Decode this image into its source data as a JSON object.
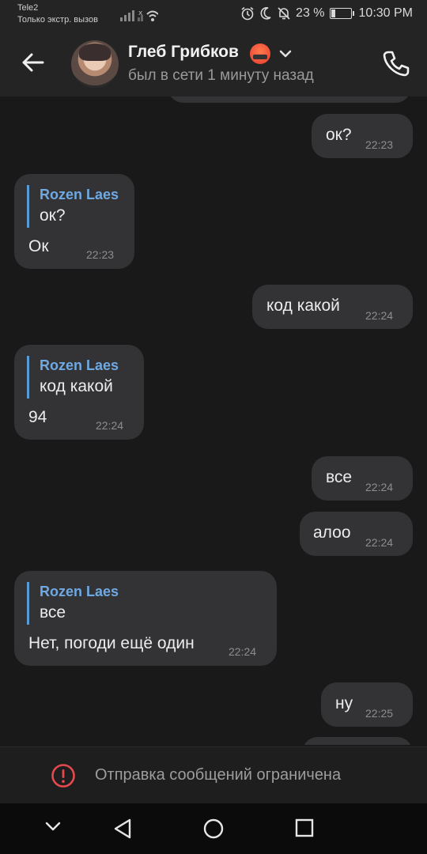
{
  "status_bar": {
    "carrier": "Tele2",
    "carrier_sub": "Только экстр. вызов",
    "battery": "23 %",
    "battery_level": 0.23,
    "time": "10:30 PM"
  },
  "header": {
    "name": "Глеб Грибков",
    "last_seen": "был в сети 1 минуту назад"
  },
  "messages": [
    {
      "text": "ок?",
      "time": "22:23"
    },
    {
      "reply_name": "Rozen Laes",
      "reply_text": "ок?",
      "text": "Ок",
      "time": "22:23"
    },
    {
      "text": "код какой",
      "time": "22:24"
    },
    {
      "reply_name": "Rozen Laes",
      "reply_text": "код какой",
      "text": "94",
      "time": "22:24"
    },
    {
      "text": "все",
      "time": "22:24"
    },
    {
      "text": "алоо",
      "time": "22:24"
    },
    {
      "reply_name": "Rozen Laes",
      "reply_text": "все",
      "text": "Нет, погоди ещё один",
      "time": "22:24"
    },
    {
      "text": "ну",
      "time": "22:25"
    }
  ],
  "restriction": {
    "text": "Отправка сообщений ограничена"
  },
  "colors": {
    "background": "#191919",
    "bubble": "#333335",
    "accent_blue": "#6fa9e3",
    "warning_red": "#e5484d"
  }
}
